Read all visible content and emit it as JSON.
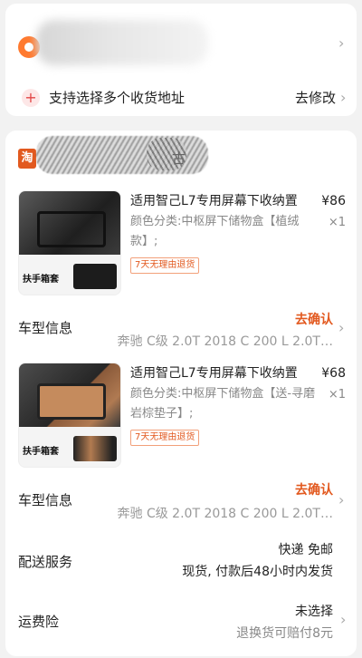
{
  "address": {
    "multi_address_text": "支持选择多个收货地址",
    "edit_label": "去修改"
  },
  "shop": {
    "logo_text": "淘",
    "name_visible_char": "古"
  },
  "items": [
    {
      "title": "适用智己L7专用屏幕下收纳置",
      "spec": "颜色分类:中枢屏下储物盒【植绒款】;",
      "price": "¥86",
      "qty": "×1",
      "return_tag": "7天无理由退货",
      "thumb_label": "扶手箱套",
      "car_label": "车型信息",
      "car_confirm": "去确认",
      "car_model": "奔驰 C级 2.0T 2018 C 200 L 2.0T…"
    },
    {
      "title": "适用智己L7专用屏幕下收纳置",
      "spec": "颜色分类:中枢屏下储物盒【送-寻磨岩棕垫子】;",
      "price": "¥68",
      "qty": "×1",
      "return_tag": "7天无理由退货",
      "thumb_label": "扶手箱套",
      "car_label": "车型信息",
      "car_confirm": "去确认",
      "car_model": "奔驰 C级 2.0T 2018 C 200 L 2.0T…"
    }
  ],
  "delivery": {
    "label": "配送服务",
    "line1": "快递 免邮",
    "line2": "现货, 付款后48小时内发货"
  },
  "insurance": {
    "label": "运费险",
    "line1": "未选择",
    "line2": "退换货可赔付8元"
  },
  "icons": {
    "location": "location-icon",
    "plus": "plus-icon",
    "chevron": "chevron-right-icon"
  },
  "colors": {
    "accent": "#e2591f",
    "location": "#ff7a2f",
    "plus": "#e24646"
  }
}
